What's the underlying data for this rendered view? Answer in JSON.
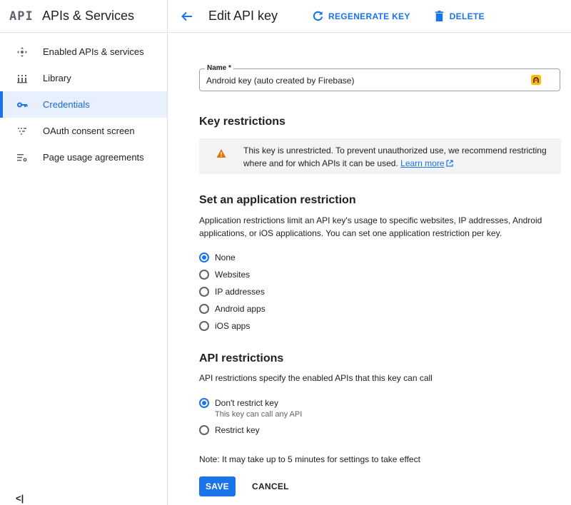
{
  "sidebar": {
    "logo": "API",
    "title": "APIs & Services",
    "items": [
      {
        "label": "Enabled APIs & services",
        "icon": "enabled-apis-icon"
      },
      {
        "label": "Library",
        "icon": "library-icon"
      },
      {
        "label": "Credentials",
        "icon": "key-icon",
        "active": true
      },
      {
        "label": "OAuth consent screen",
        "icon": "consent-grid-icon"
      },
      {
        "label": "Page usage agreements",
        "icon": "settings-list-icon"
      }
    ],
    "collapse_label": "<|"
  },
  "header": {
    "title": "Edit API key",
    "regenerate_label": "REGENERATE KEY",
    "delete_label": "DELETE"
  },
  "form": {
    "name_label": "Name *",
    "name_value": "Android key (auto created by Firebase)"
  },
  "key_restrictions": {
    "heading": "Key restrictions",
    "warning_text": "This key is unrestricted. To prevent unauthorized use, we recommend restricting where and for which APIs it can be used.",
    "learn_more": "Learn more"
  },
  "app_restriction": {
    "heading": "Set an application restriction",
    "description": "Application restrictions limit an API key's usage to specific websites, IP addresses, Android applications, or iOS applications. You can set one application restriction per key.",
    "options": [
      {
        "label": "None",
        "checked": true
      },
      {
        "label": "Websites",
        "checked": false
      },
      {
        "label": "IP addresses",
        "checked": false
      },
      {
        "label": "Android apps",
        "checked": false
      },
      {
        "label": "iOS apps",
        "checked": false
      }
    ]
  },
  "api_restriction": {
    "heading": "API restrictions",
    "description": "API restrictions specify the enabled APIs that this key can call",
    "options": [
      {
        "label": "Don't restrict key",
        "sub": "This key can call any API",
        "checked": true
      },
      {
        "label": "Restrict key",
        "checked": false
      }
    ]
  },
  "footer": {
    "note": "Note: It may take up to 5 minutes for settings to take effect",
    "save_label": "SAVE",
    "cancel_label": "CANCEL"
  },
  "colors": {
    "accent": "#1a73e8",
    "active_bg": "#e8f0fe",
    "warning": "#e37400",
    "badge": "#fbbc04"
  }
}
